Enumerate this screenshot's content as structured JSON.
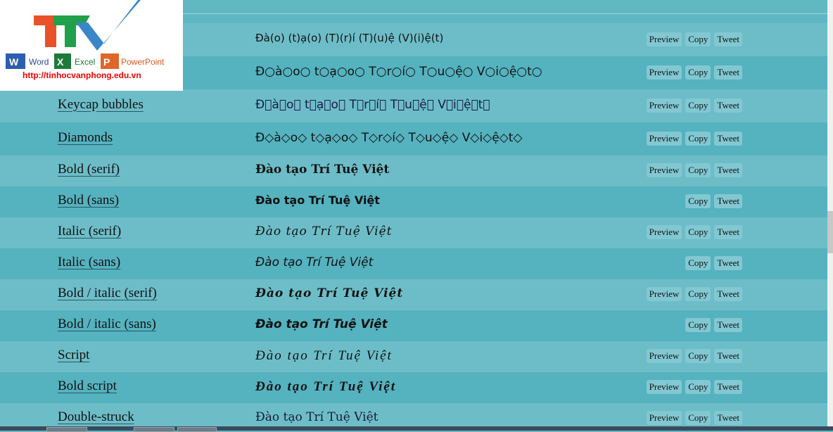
{
  "logo": {
    "brand": "TTV",
    "apps": [
      "Word",
      "Excel",
      "PowerPoint"
    ],
    "url": "http://tinhocvanphong.edu.vn"
  },
  "buttons": {
    "preview": "Preview",
    "copy": "Copy",
    "tweet": "Tweet"
  },
  "rows": [
    {
      "label": "",
      "sample": "Đà(o) (t)ạ(o) (T)(r)í (T)(u)ệ (V)(i)ệ(t)",
      "preview": true
    },
    {
      "label": "",
      "sample": "Đ○à○o○ t○ạ○o○ T○r○í○ T○u○ệ○ V○i○ệ○t○",
      "preview": true
    },
    {
      "label": "Keycap bubbles",
      "sample": "Đ⃣à⃣o⃣ t⃣ạ⃣o⃣ T⃣r⃣í⃣ T⃣u⃣ệ⃣ V⃣i⃣ệ⃣t⃣",
      "preview": true
    },
    {
      "label": "Diamonds",
      "sample": "Đ◇à◇o◇ t◇ạ◇o◇ T◇r◇í◇ T◇u◇ệ◇ V◇i◇ệ◇t◇",
      "preview": true
    },
    {
      "label": "Bold (serif)",
      "sample": "Đào tạo Trí Tuệ Việt",
      "preview": true
    },
    {
      "label": "Bold (sans)",
      "sample": "Đào tạo Trí Tuệ Việt",
      "preview": false
    },
    {
      "label": "Italic (serif)",
      "sample": "Đào tạo Trí Tuệ Việt",
      "preview": true
    },
    {
      "label": "Italic (sans)",
      "sample": "Đào tạo Trí Tuệ Việt",
      "preview": false
    },
    {
      "label": "Bold / italic (serif)",
      "sample": "Đào tạo Trí Tuệ Việt",
      "preview": true
    },
    {
      "label": "Bold / italic (sans)",
      "sample": "Đào tạo Trí Tuệ Việt",
      "preview": false
    },
    {
      "label": "Script",
      "sample": "Đào tạo Trí Tuệ Việt",
      "preview": true
    },
    {
      "label": "Bold script",
      "sample": "Đào tạo Trí Tuệ Việt",
      "preview": true
    },
    {
      "label": "Double-struck",
      "sample": "Đào tạo Trí Tuệ Việt",
      "preview": true
    }
  ]
}
